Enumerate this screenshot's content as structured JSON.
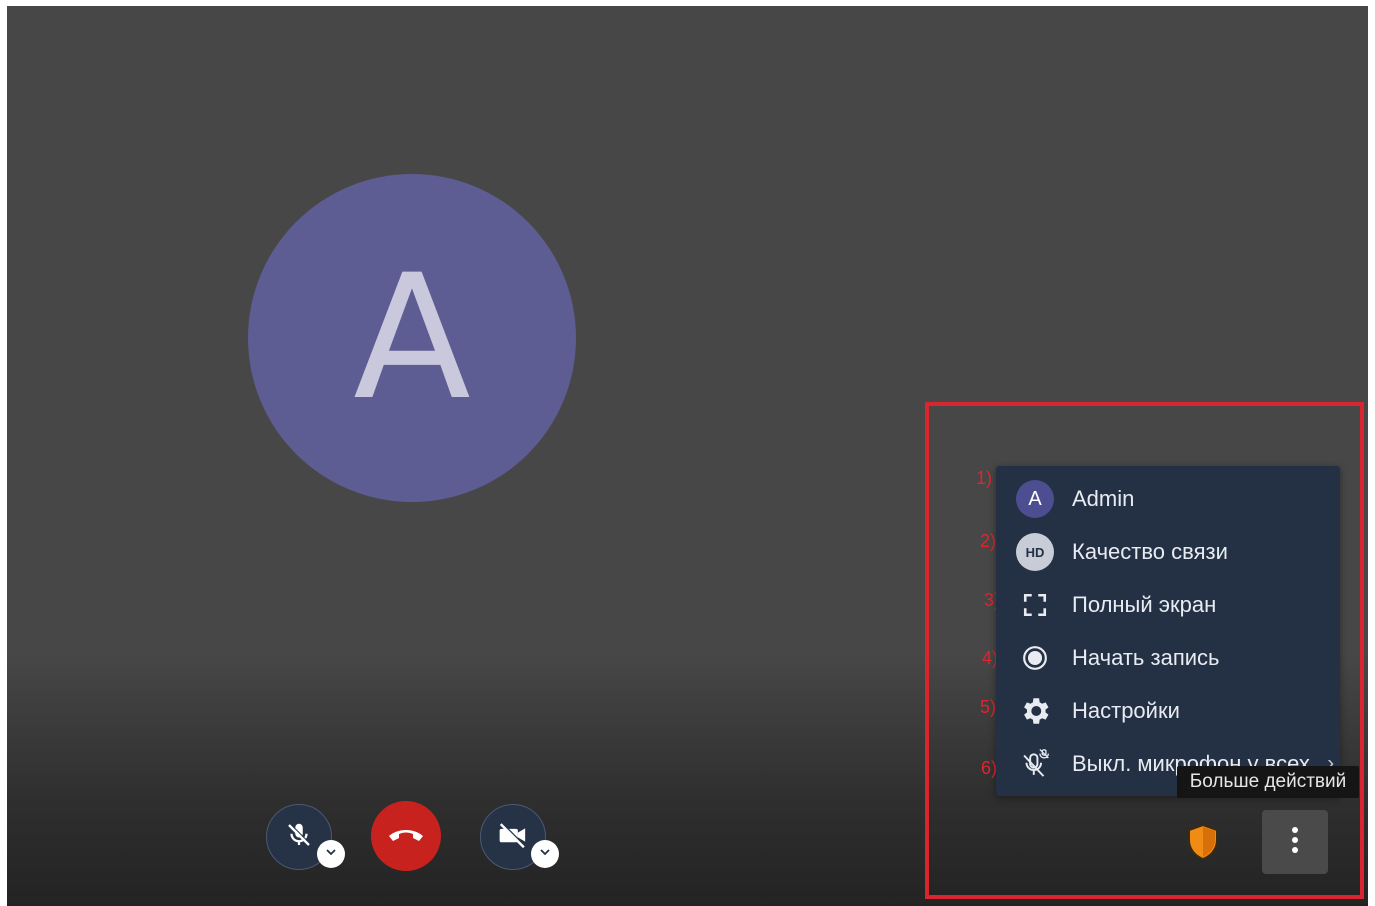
{
  "participant": {
    "avatar_letter": "A"
  },
  "controls": {
    "mic_icon": "mic-off-icon",
    "hangup_icon": "phone-hangup-icon",
    "camera_icon": "camera-off-icon",
    "chevron_icon": "chevron-down-icon"
  },
  "menu": {
    "items": [
      {
        "number": "1)",
        "icon": "avatar",
        "icon_text": "A",
        "label": "Admin"
      },
      {
        "number": "2)",
        "icon": "hd-icon",
        "icon_text": "HD",
        "label": "Качество связи"
      },
      {
        "number": "3)",
        "icon": "fullscreen-icon",
        "label": "Полный экран"
      },
      {
        "number": "4)",
        "icon": "record-icon",
        "label": "Начать запись"
      },
      {
        "number": "5)",
        "icon": "gear-icon",
        "label": "Настройки"
      },
      {
        "number": "6)",
        "icon": "mute-all-icon",
        "label": "Выкл. микрофон у всех",
        "arrow": "›"
      }
    ]
  },
  "tooltip": {
    "text": "Больше действий"
  },
  "colors": {
    "background": "#474747",
    "menu_bg": "#243044",
    "hangup": "#c8221f",
    "highlight_box": "#d9252d",
    "avatar": "#5e5d93"
  }
}
